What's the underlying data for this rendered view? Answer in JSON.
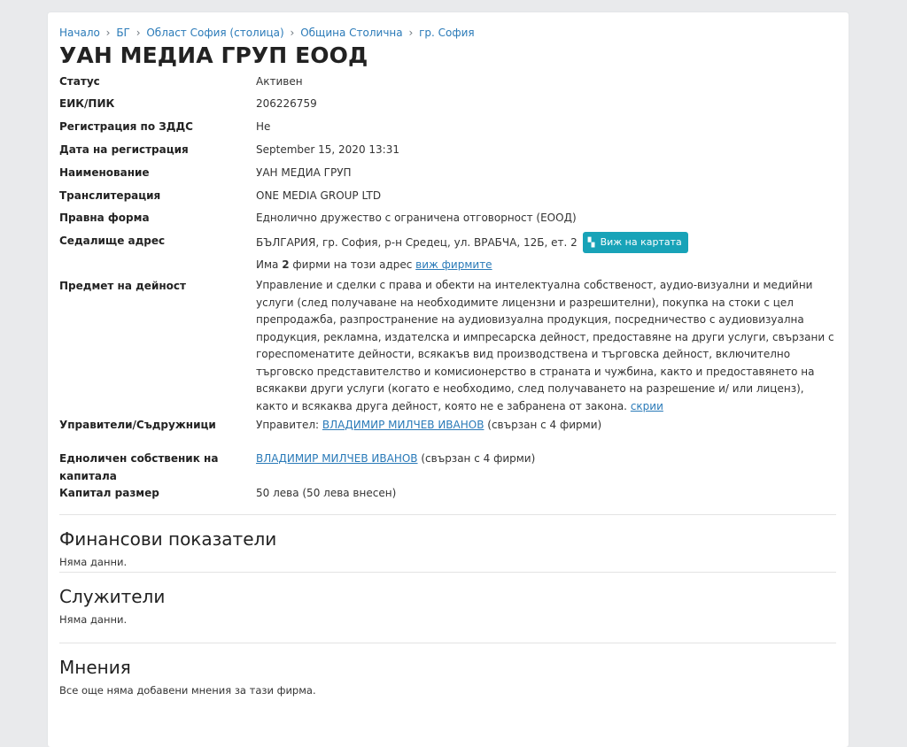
{
  "breadcrumb": [
    {
      "label": "Начало"
    },
    {
      "label": "БГ"
    },
    {
      "label": "Област София (столица)"
    },
    {
      "label": "Община Столична"
    },
    {
      "label": "гр. София"
    }
  ],
  "breadcrumb_separator": "›",
  "company_title": "УАН МЕДИА ГРУП ЕООД",
  "details": {
    "status_label": "Статус",
    "status_value": "Активен",
    "eik_label": "ЕИК/ПИК",
    "eik_value": "206226759",
    "vat_label": "Регистрация по ЗДДС",
    "vat_value": "Не",
    "reg_date_label": "Дата на регистрация",
    "reg_date_value": "September 15, 2020 13:31",
    "name_label": "Наименование",
    "name_value": "УАН МЕДИА ГРУП",
    "translit_label": "Транслитерация",
    "translit_value": "ONE MEDIA GROUP LTD",
    "legal_form_label": "Правна форма",
    "legal_form_value": "Еднолично дружество с ограничена отговорност (ЕООД)",
    "address_label": "Седалище адрес",
    "address_value": "БЪЛГАРИЯ, гр. София, р-н Средец, ул. ВРАБЧА, 12Б, ет. 2",
    "map_button_label": "Виж на картата",
    "map_button_icon": "map-icon",
    "address_firms_prefix": "Има",
    "address_firms_count": "2",
    "address_firms_suffix": "фирми на този адрес",
    "address_firms_link": "виж фирмите",
    "activity_label": "Предмет на дейност",
    "activity_value": "Управление и сделки с права и обекти на интелектуална собственост, аудио-визуални и медийни услуги (след получаване на необходимите лицензни и разрешителни), покупка на стоки с цел препродажба, разпространение на аудиовизуална продукция, посредничество с аудиовизуална продукция, рекламна, издателска и импресарска дейност, предоставяне на други услуги, свързани с гореспоменатите дейности, всякакъв вид производствена и търговска дейност, включително търговско представителство и комисионерство в страната и чужбина, както и предоставянето на всякакви други услуги (когато е необходимо, след получаването на разрешение и/ или лиценз), както и всякаква друга дейност, която не е забранена от закона.",
    "activity_hide_link": "скрии",
    "managers_label": "Управители/Съдружници",
    "managers_prefix": "Управител:",
    "managers_name": "ВЛАДИМИР МИЛЧЕВ ИВАНОВ",
    "managers_suffix": "(свързан с 4 фирми)",
    "owner_label": "Едноличен собственик на капитала",
    "owner_name": "ВЛАДИМИР МИЛЧЕВ ИВАНОВ",
    "owner_suffix": "(свързан с 4 фирми)",
    "capital_label": "Капитал размер",
    "capital_value": "50 лева (50 лева внесен)"
  },
  "sections": {
    "financial_title": "Финансови показатели",
    "financial_note": "Няма данни.",
    "employees_title": "Служители",
    "employees_note": "Няма данни.",
    "reviews_title": "Мнения",
    "reviews_note": "Все още няма добавени мнения за тази фирма."
  },
  "colors": {
    "link": "#2a7ab8",
    "status_active": "#3aa15a",
    "map_button": "#18a3b8",
    "background": "#e9eaec"
  }
}
